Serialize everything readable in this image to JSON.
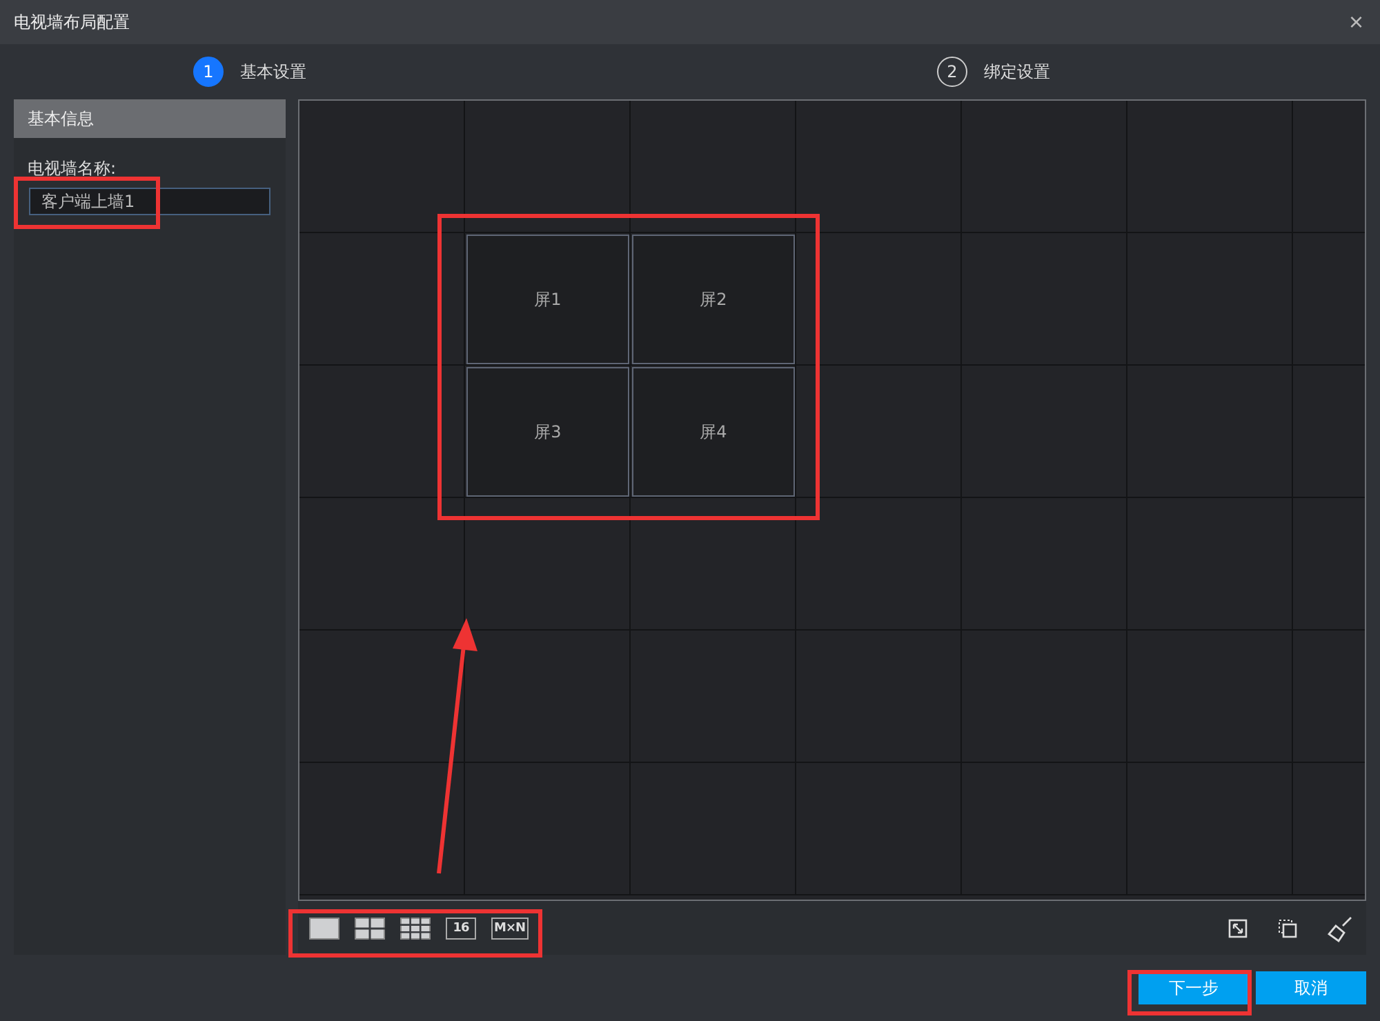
{
  "window": {
    "title": "电视墙布局配置",
    "close": "×"
  },
  "steps": [
    {
      "number": "1",
      "label": "基本设置",
      "selected": true
    },
    {
      "number": "2",
      "label": "绑定设置",
      "selected": false
    }
  ],
  "sidebar": {
    "header": "基本信息",
    "name_label": "电视墙名称:",
    "name_value": "客户端上墙1"
  },
  "screens": [
    {
      "label": "屏1"
    },
    {
      "label": "屏2"
    },
    {
      "label": "屏3"
    },
    {
      "label": "屏4"
    }
  ],
  "layout_buttons": [
    {
      "kind": "single"
    },
    {
      "kind": "quad"
    },
    {
      "kind": "nine"
    },
    {
      "kind": "text",
      "label": "16"
    },
    {
      "kind": "text",
      "label": "M×N"
    }
  ],
  "buttons": [
    {
      "label": "下一步"
    },
    {
      "label": "取消"
    }
  ]
}
